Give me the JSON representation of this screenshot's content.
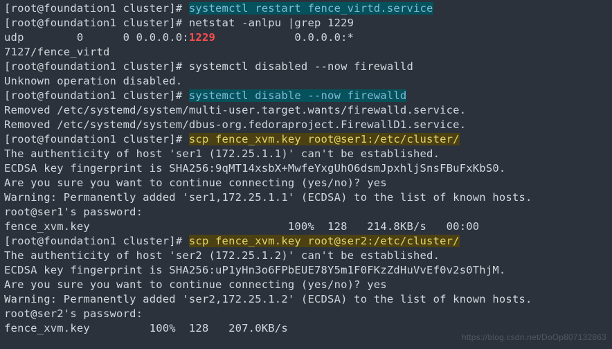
{
  "lines": [
    {
      "segments": [
        {
          "type": "prompt",
          "text": "[root@foundation1 cluster]# "
        },
        {
          "type": "hi",
          "text": "systemctl restart fence_virtd.service"
        }
      ]
    },
    {
      "segments": [
        {
          "type": "prompt",
          "text": "[root@foundation1 cluster]# "
        },
        {
          "type": "plain",
          "text": "netstat -anlpu |grep 1229"
        }
      ]
    },
    {
      "segments": [
        {
          "type": "plain",
          "text": "udp        0      0 0.0.0.0:"
        },
        {
          "type": "red",
          "text": "1229"
        },
        {
          "type": "plain",
          "text": "            0.0.0.0:*"
        }
      ]
    },
    {
      "segments": [
        {
          "type": "plain",
          "text": "7127/fence_virtd"
        }
      ]
    },
    {
      "segments": [
        {
          "type": "prompt",
          "text": "[root@foundation1 cluster]# "
        },
        {
          "type": "plain",
          "text": "systemctl disabled --now firewalld"
        }
      ]
    },
    {
      "segments": [
        {
          "type": "plain",
          "text": "Unknown operation disabled."
        }
      ]
    },
    {
      "segments": [
        {
          "type": "prompt",
          "text": "[root@foundation1 cluster]# "
        },
        {
          "type": "hi",
          "text": "systemctl disable --now firewalld"
        }
      ]
    },
    {
      "segments": [
        {
          "type": "plain",
          "text": "Removed /etc/systemd/system/multi-user.target.wants/firewalld.service."
        }
      ]
    },
    {
      "segments": [
        {
          "type": "plain",
          "text": "Removed /etc/systemd/system/dbus-org.fedoraproject.FirewallD1.service."
        }
      ]
    },
    {
      "segments": [
        {
          "type": "prompt",
          "text": "[root@foundation1 cluster]# "
        },
        {
          "type": "yel",
          "text": "scp fence_xvm.key root@ser1:/etc/cluster/"
        }
      ]
    },
    {
      "segments": [
        {
          "type": "plain",
          "text": "The authenticity of host 'ser1 (172.25.1.1)' can't be established."
        }
      ]
    },
    {
      "segments": [
        {
          "type": "plain",
          "text": "ECDSA key fingerprint is SHA256:9qMT14xsbX+MwfeYxgUhO6dsmJpxhljSnsFBuFxKbS0."
        }
      ]
    },
    {
      "segments": [
        {
          "type": "plain",
          "text": "Are you sure you want to continue connecting (yes/no)? yes"
        }
      ]
    },
    {
      "segments": [
        {
          "type": "plain",
          "text": "Warning: Permanently added 'ser1,172.25.1.1' (ECDSA) to the list of known hosts."
        }
      ]
    },
    {
      "segments": [
        {
          "type": "plain",
          "text": "root@ser1's password:"
        }
      ]
    },
    {
      "segments": [
        {
          "type": "plain",
          "text": "fence_xvm.key                              100%  128   214.8KB/s   00:00"
        }
      ]
    },
    {
      "segments": [
        {
          "type": "prompt",
          "text": "[root@foundation1 cluster]# "
        },
        {
          "type": "yel",
          "text": "scp fence_xvm.key root@ser2:/etc/cluster/"
        }
      ]
    },
    {
      "segments": [
        {
          "type": "plain",
          "text": "The authenticity of host 'ser2 (172.25.1.2)' can't be established."
        }
      ]
    },
    {
      "segments": [
        {
          "type": "plain",
          "text": "ECDSA key fingerprint is SHA256:uP1yHn3o6FPbEUE78Y5m1F0FKzZdHuVvEf0v2s0ThjM."
        }
      ]
    },
    {
      "segments": [
        {
          "type": "plain",
          "text": "Are you sure you want to continue connecting (yes/no)? yes"
        }
      ]
    },
    {
      "segments": [
        {
          "type": "plain",
          "text": "Warning: Permanently added 'ser2,172.25.1.2' (ECDSA) to the list of known hosts."
        }
      ]
    },
    {
      "segments": [
        {
          "type": "plain",
          "text": "root@ser2's password:"
        }
      ]
    },
    {
      "segments": [
        {
          "type": "plain",
          "text": "fence_xvm.key         100%  128   207.0KB/s"
        }
      ]
    }
  ],
  "watermark": "https://blog.csdn.net/DoOp807132863"
}
